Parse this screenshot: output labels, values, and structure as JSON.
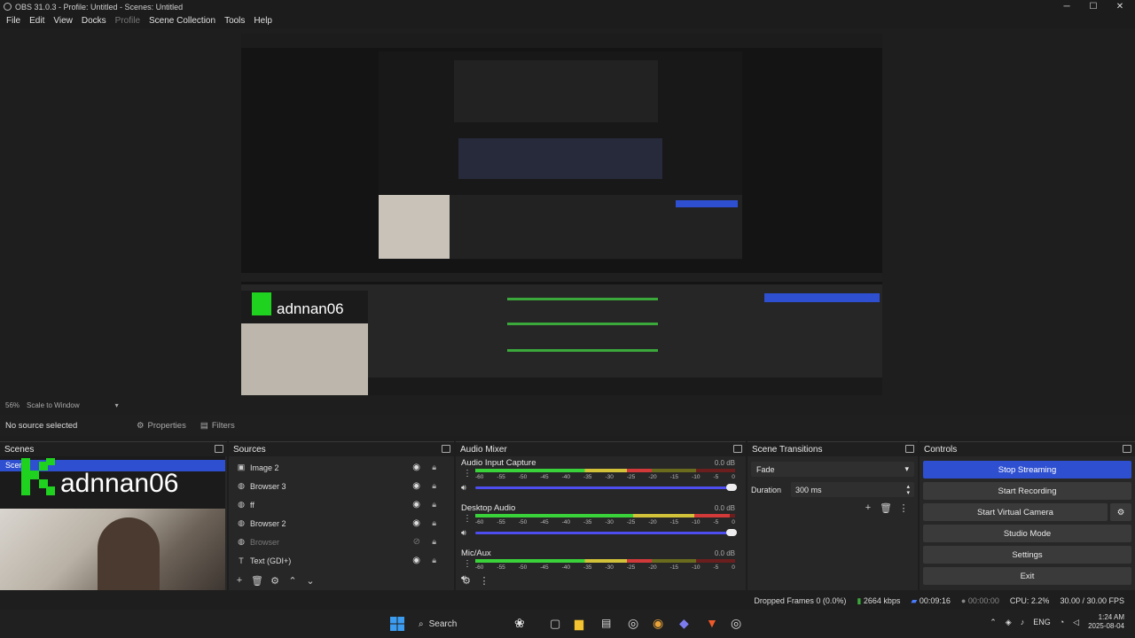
{
  "window": {
    "title": "OBS 31.0.3 - Profile: Untitled - Scenes: Untitled"
  },
  "menu": [
    "File",
    "Edit",
    "View",
    "Docks",
    "Profile",
    "Scene Collection",
    "Tools",
    "Help"
  ],
  "preview": {
    "zoom": "56%",
    "scale_mode": "Scale to Window"
  },
  "source_bar": {
    "status": "No source selected",
    "properties_label": "Properties",
    "filters_label": "Filters"
  },
  "scenes": {
    "title": "Scenes",
    "items": [
      "Scen"
    ],
    "overlay_text": "adnnan06"
  },
  "sources": {
    "title": "Sources",
    "items": [
      {
        "label": "Image 2",
        "visible": true,
        "icon": "image-icon"
      },
      {
        "label": "Browser 3",
        "visible": true,
        "icon": "globe-icon"
      },
      {
        "label": "ff",
        "visible": true,
        "icon": "globe-icon"
      },
      {
        "label": "Browser 2",
        "visible": true,
        "icon": "globe-icon"
      },
      {
        "label": "Browser",
        "visible": false,
        "icon": "globe-icon"
      },
      {
        "label": "Text (GDI+)",
        "visible": true,
        "icon": "text-icon"
      }
    ]
  },
  "audio_mixer": {
    "title": "Audio Mixer",
    "ticks": [
      "-60",
      "-55",
      "-50",
      "-45",
      "-40",
      "-35",
      "-30",
      "-25",
      "-20",
      "-15",
      "-10",
      "-5",
      "0"
    ],
    "channels": [
      {
        "name": "Audio Input Capture",
        "db": "0.0 dB",
        "level": 0.68
      },
      {
        "name": "Desktop Audio",
        "db": "0.0 dB",
        "level": 0.98
      },
      {
        "name": "Mic/Aux",
        "db": "0.0 dB",
        "level": 0.68
      }
    ]
  },
  "scene_transitions": {
    "title": "Scene Transitions",
    "transition": "Fade",
    "duration_label": "Duration",
    "duration_value": "300 ms"
  },
  "controls": {
    "title": "Controls",
    "stop_streaming": "Stop Streaming",
    "start_recording": "Start Recording",
    "start_virtual_camera": "Start Virtual Camera",
    "studio_mode": "Studio Mode",
    "settings": "Settings",
    "exit": "Exit"
  },
  "status": {
    "dropped_frames": "Dropped Frames 0 (0.0%)",
    "bitrate": "2664 kbps",
    "stream_time": "00:09:16",
    "record_time": "00:00:00",
    "cpu": "CPU: 2.2%",
    "fps": "30.00 / 30.00 FPS"
  },
  "taskbar": {
    "search": "Search",
    "language": "ENG",
    "time": "1:24 AM",
    "date": "2025-08-04"
  },
  "colors": {
    "accent": "#2e4fd0",
    "background": "#1e1e1e",
    "dock": "#272727"
  }
}
